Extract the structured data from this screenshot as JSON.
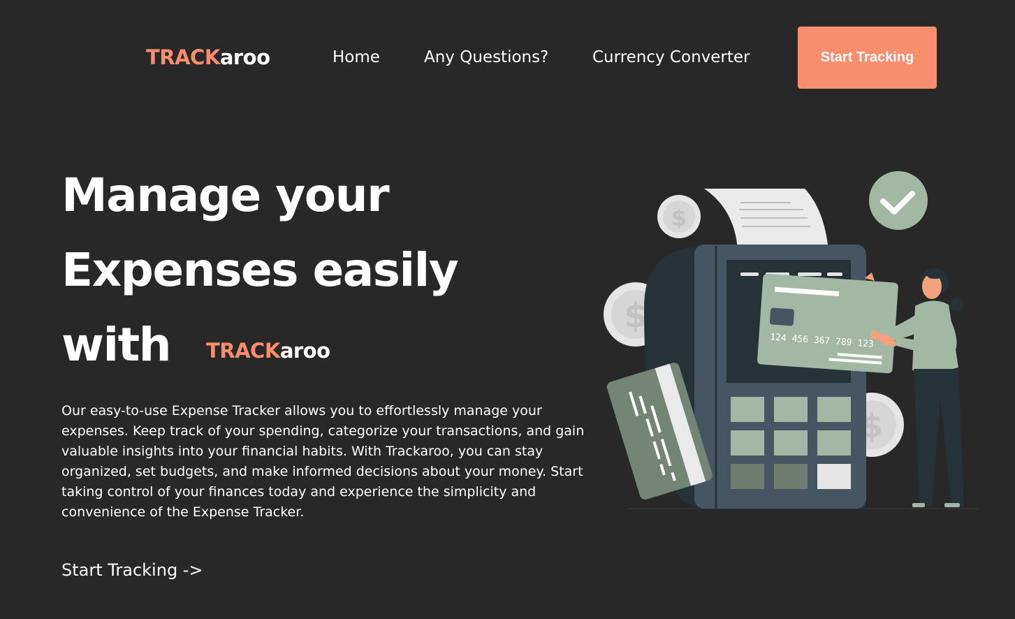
{
  "nav": {
    "logo": {
      "primary": "TRACK",
      "secondary": "aroo"
    },
    "links": [
      {
        "label": "Home"
      },
      {
        "label": "Any Questions?"
      },
      {
        "label": "Currency Converter"
      }
    ],
    "cta_label": "Start Tracking"
  },
  "hero": {
    "title_lines": [
      "Manage your",
      "Expenses easily",
      "with"
    ],
    "brand": {
      "primary": "TRACK",
      "secondary": "aroo"
    },
    "description": "Our easy-to-use Expense Tracker allows you to effortlessly manage your expenses. Keep track of your spending, categorize your transactions, and gain valuable insights into your financial habits. With Trackaroo, you can stay organized, set budgets, and make informed decisions about your money. Start taking control of your finances today and experience the simplicity and convenience of the Expense Tracker.",
    "cta_label": "Start Tracking ->"
  },
  "illustration": {
    "card_number": "124 456 367 789 123",
    "coin_symbol": "$",
    "icons": [
      "coin-icon",
      "checkmark-icon",
      "credit-card-icon",
      "payment-terminal-icon",
      "receipt-icon",
      "person-figure"
    ]
  },
  "colors": {
    "background": "#282828",
    "accent": "#f88e6d",
    "sage": "#a2b8a4",
    "terminal": "#455561",
    "dark": "#263238",
    "coin": "#e5e5e5"
  }
}
